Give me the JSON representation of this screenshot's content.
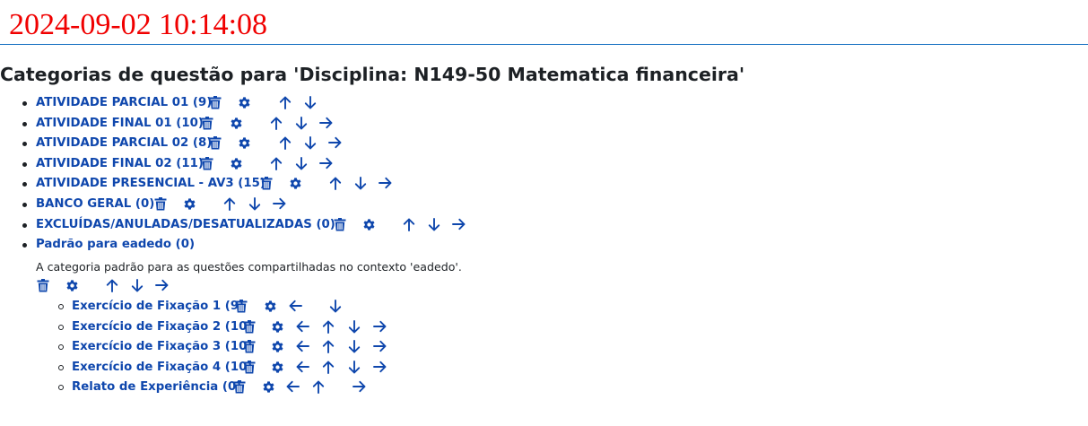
{
  "header": {
    "timestamp": "2024-09-02 10:14:08",
    "title": "Categorias de questão para 'Disciplina: N149-50 Matematica financeira'"
  },
  "colors": {
    "timestamp": "#f00000",
    "link": "#0f47ad",
    "rule": "#0f6cbf",
    "text": "#1d2125"
  },
  "icons": {
    "delete": "trash-icon",
    "edit": "gear-icon",
    "move_up": "arrow-up-icon",
    "move_down": "arrow-down-icon",
    "indent": "arrow-right-icon",
    "outdent": "arrow-left-icon"
  },
  "categories": [
    {
      "label": "ATIVIDADE PARCIAL 01 (9)"
    },
    {
      "label": "ATIVIDADE FINAL 01 (10)"
    },
    {
      "label": "ATIVIDADE PARCIAL 02 (8)"
    },
    {
      "label": "ATIVIDADE FINAL 02 (11)"
    },
    {
      "label": "ATIVIDADE PRESENCIAL - AV3 (15)"
    },
    {
      "label": "BANCO GERAL (0)"
    },
    {
      "label": "EXCLUÍDAS/ANULADAS/DESATUALIZADAS (0)"
    },
    {
      "label": "Padrão para eadedo (0)",
      "description": "A categoria padrão para as questões compartilhadas no contexto 'eadedo'."
    }
  ],
  "subcategories": [
    {
      "label": "Exercício de Fixação 1 (9)"
    },
    {
      "label": "Exercício de Fixação 2 (10)"
    },
    {
      "label": "Exercício de Fixação 3 (10)"
    },
    {
      "label": "Exercício de Fixação 4 (10)"
    },
    {
      "label": "Relato de Experiência (0)"
    }
  ]
}
